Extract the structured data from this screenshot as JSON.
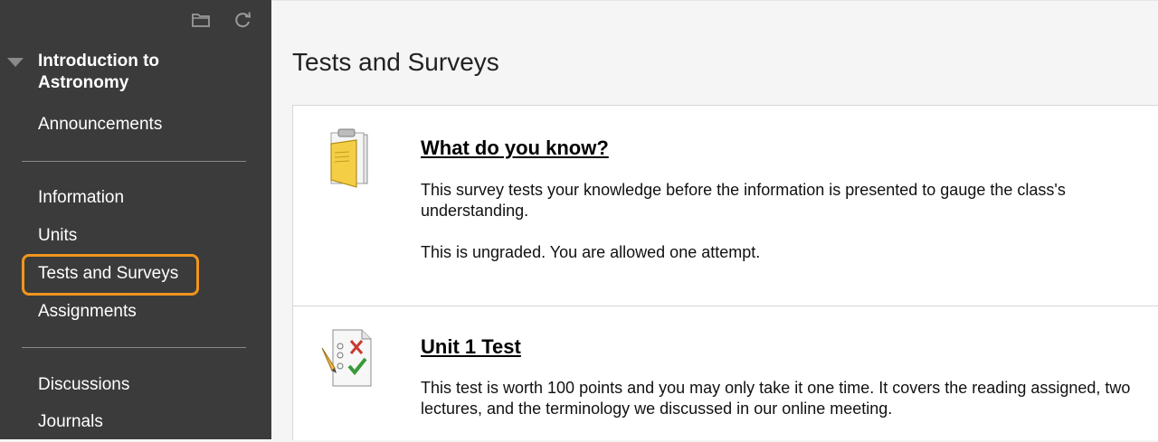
{
  "sidebar": {
    "tools": [
      {
        "icon": "folder-icon"
      },
      {
        "icon": "refresh-icon"
      }
    ],
    "course_title": "Introduction to Astronomy",
    "items": [
      {
        "label": "Announcements"
      },
      {
        "label": "Information"
      },
      {
        "label": "Units"
      },
      {
        "label": "Tests and Surveys",
        "active": true
      },
      {
        "label": "Assignments"
      },
      {
        "label": "Discussions"
      },
      {
        "label": "Journals"
      }
    ],
    "colors": {
      "background": "#3b3b3b",
      "active_outline": "#f0961e"
    }
  },
  "main": {
    "title": "Tests and Surveys",
    "items": [
      {
        "icon": "survey-clipboard-icon",
        "title": "What do you know?",
        "description": "This survey tests your knowledge before the information is presented to gauge the class's understanding.",
        "note": "This is ungraded. You are allowed one attempt."
      },
      {
        "icon": "test-checklist-icon",
        "title": "Unit 1 Test",
        "description": "This test is worth 100 points and you may only take it one time. It covers the reading assigned, two lectures, and the terminology we discussed in our online meeting."
      }
    ]
  }
}
